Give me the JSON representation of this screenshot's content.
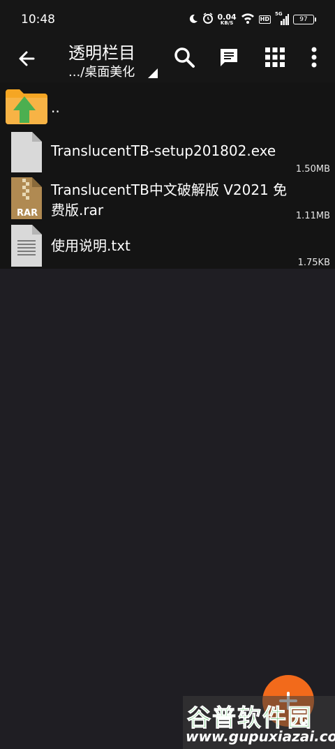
{
  "status_bar": {
    "time": "10:48",
    "net_speed_value": "0.04",
    "net_speed_unit": "KB/S",
    "hd_label": "HD",
    "signal_label": "5G",
    "battery": "97"
  },
  "app_bar": {
    "title": "透明栏目",
    "path": ".../桌面美化"
  },
  "files": [
    {
      "name": "..",
      "size": ""
    },
    {
      "name": "TranslucentTB-setup201802.exe",
      "size": "1.50MB"
    },
    {
      "name": "TranslucentTB中文破解版 V2021 免费版.rar",
      "size": "1.11MB"
    },
    {
      "name": "使用说明.txt",
      "size": "1.75KB"
    }
  ],
  "rar_label": "RAR",
  "watermark": {
    "name": "谷普软件园",
    "url": "www.gupuxiazai.com"
  },
  "colors": {
    "background": "#1f1e23",
    "bar": "#161616",
    "fab": "#f26a1b",
    "folder": "#f5a623",
    "up_arrow": "#4caf50"
  }
}
